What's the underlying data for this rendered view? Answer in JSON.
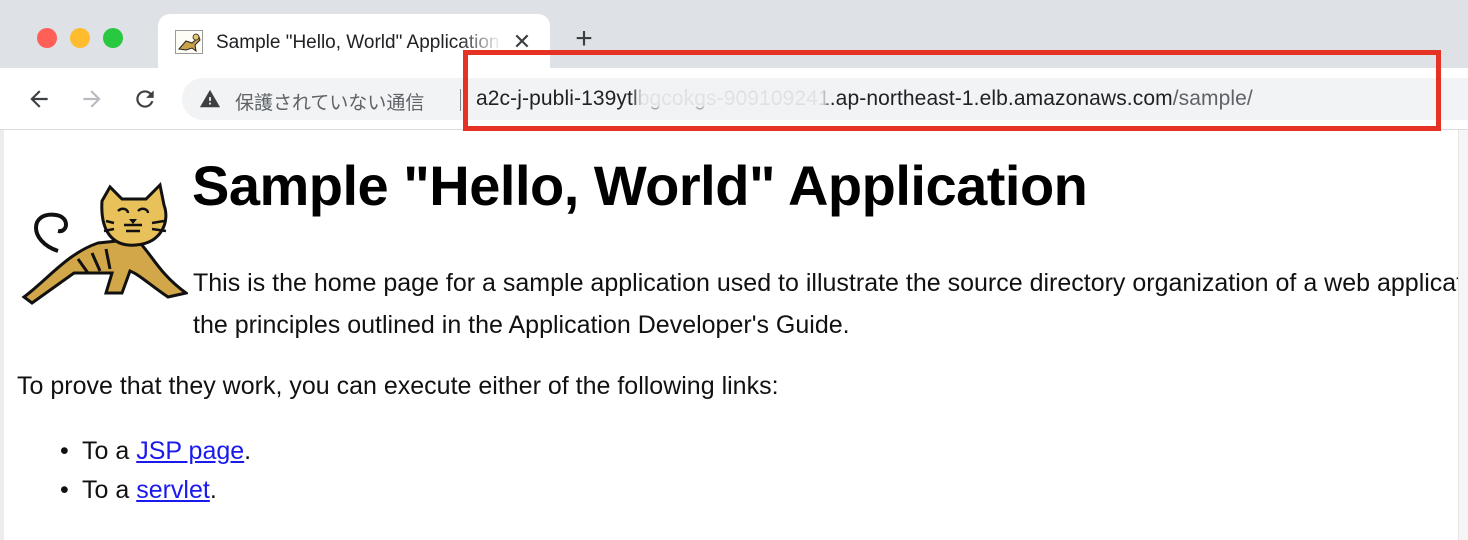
{
  "browser": {
    "tab": {
      "title": "Sample \"Hello, World\" Application",
      "close_glyph": "✕",
      "favicon": "tomcat-icon"
    },
    "new_tab_glyph": "+",
    "toolbar": {
      "back_icon": "arrow-left-icon",
      "forward_icon": "arrow-right-icon",
      "reload_icon": "reload-icon"
    },
    "omnibox": {
      "security_icon": "warning-triangle-icon",
      "security_label": "保護されていない通信",
      "url_host": "a2c-j-publi-139ytlbgcokgs-909109241.ap-northeast-1.elb.amazonaws.com",
      "url_path": "/sample/"
    }
  },
  "annotation": {
    "color": "#e53225"
  },
  "page": {
    "title": "Sample \"Hello, World\" Application",
    "intro_line1": "This is the home page for a sample application used to illustrate the source directory organization of a web application utilizing",
    "intro_line2": "the principles outlined in the Application Developer's Guide.",
    "prove_text": "To prove that they work, you can execute either of the following links:",
    "links": [
      {
        "prefix": "To a ",
        "link_text": "JSP page",
        "suffix": "."
      },
      {
        "prefix": "To a ",
        "link_text": "servlet",
        "suffix": "."
      }
    ]
  }
}
